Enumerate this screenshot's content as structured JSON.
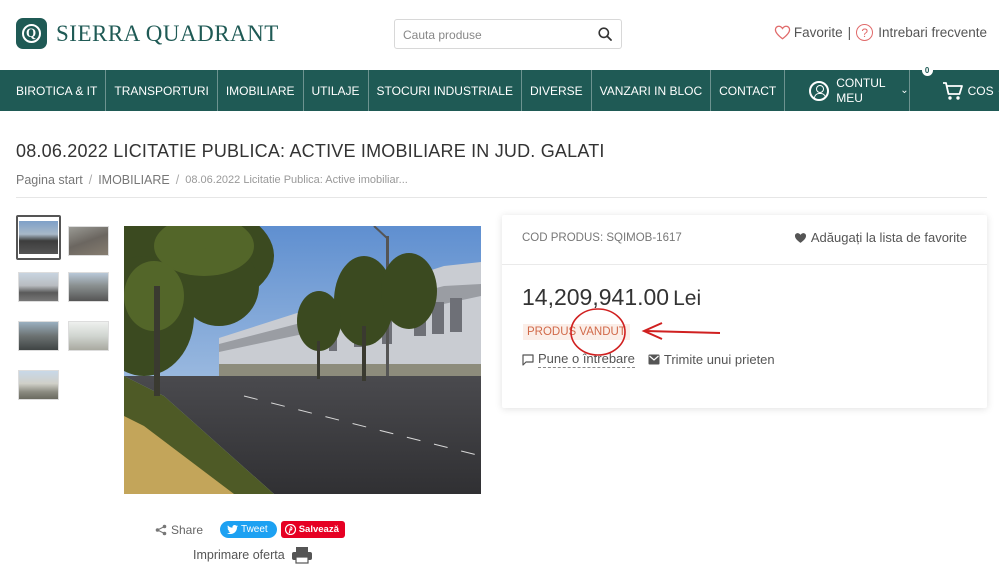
{
  "header": {
    "logo_text": "SIERRA QUADRANT",
    "logo_letter": "Q",
    "search_placeholder": "Cauta produse",
    "favorites_label": "Favorite",
    "separator": "|",
    "faq_label": "Intrebari frecvente"
  },
  "nav": {
    "items": [
      {
        "label": "BIROTICA & IT"
      },
      {
        "label": "TRANSPORTURI"
      },
      {
        "label": "IMOBILIARE"
      },
      {
        "label": "UTILAJE"
      },
      {
        "label": "STOCURI INDUSTRIALE"
      },
      {
        "label": "DIVERSE"
      },
      {
        "label": "VANZARI IN BLOC"
      },
      {
        "label": "CONTACT"
      }
    ],
    "account_label": "CONTUL MEU",
    "cart_label": "COS",
    "cart_count": "0"
  },
  "page": {
    "title": "08.06.2022 LICITATIE PUBLICA: ACTIVE IMOBILIARE IN JUD. GALATI",
    "breadcrumb": {
      "home": "Pagina start",
      "category": "IMOBILIARE",
      "current": "08.06.2022 Licitatie Publica: Active imobiliar..."
    }
  },
  "product": {
    "code_label": "COD PRODUS: SQIMOB-1617",
    "favorite_label": "Adăugați la lista de favorite",
    "price": "14,209,941.00",
    "currency": "Lei",
    "status": "PRODUS VANDUT",
    "ask_label": "Pune o întrebare",
    "send_label": "Trimite unui prieten",
    "accent_color": "#1f5a55",
    "status_color": "#d16a4a"
  },
  "share": {
    "share_label": "Share",
    "tweet_label": "Tweet",
    "pin_label": "Salvează",
    "print_label": "Imprimare oferta"
  }
}
